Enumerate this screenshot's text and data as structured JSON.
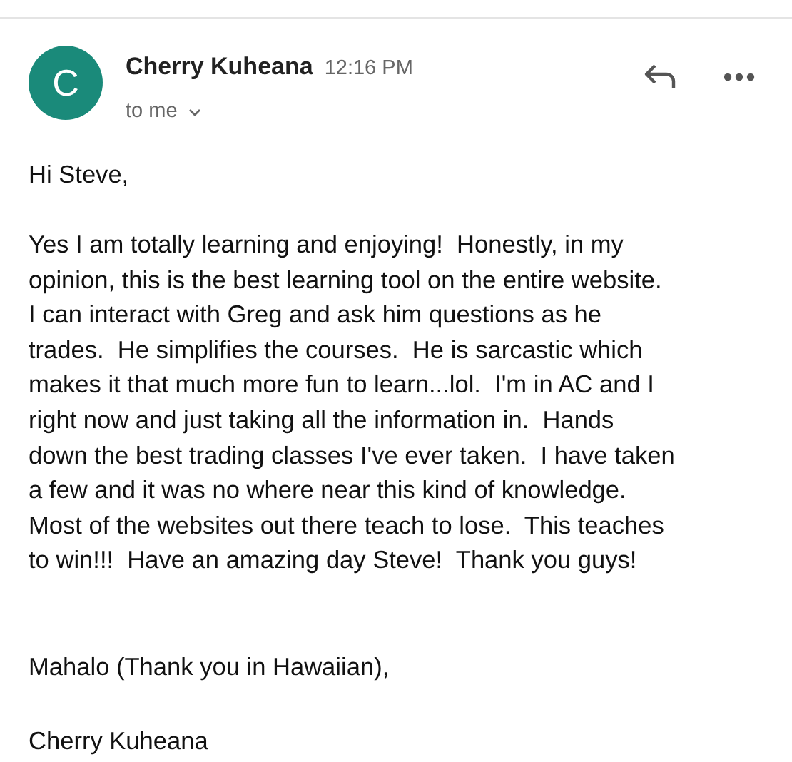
{
  "message": {
    "avatar_letter": "C",
    "sender": "Cherry Kuheana",
    "time": "12:16 PM",
    "recipient": "to me"
  },
  "body": {
    "greeting": "Hi Steve,",
    "paragraph_lines": [
      "Yes I am totally learning and enjoying!  Honestly, in my",
      "opinion, this is the best learning tool on the entire website.",
      "I can interact with Greg and ask him questions as he",
      "trades.  He simplifies the courses.  He is sarcastic which",
      "makes it that much more fun to learn...lol.  I'm in AC and I",
      "right now and just taking all the information in.  Hands",
      "down the best trading classes I've ever taken.  I have taken",
      "a few and it was no where near this kind of knowledge.",
      "Most of the websites out there teach to lose.  This teaches",
      "to win!!!  Have an amazing day Steve!  Thank you guys!"
    ],
    "closing": "Mahalo (Thank you in Hawaiian),",
    "signature": "Cherry Kuheana"
  }
}
